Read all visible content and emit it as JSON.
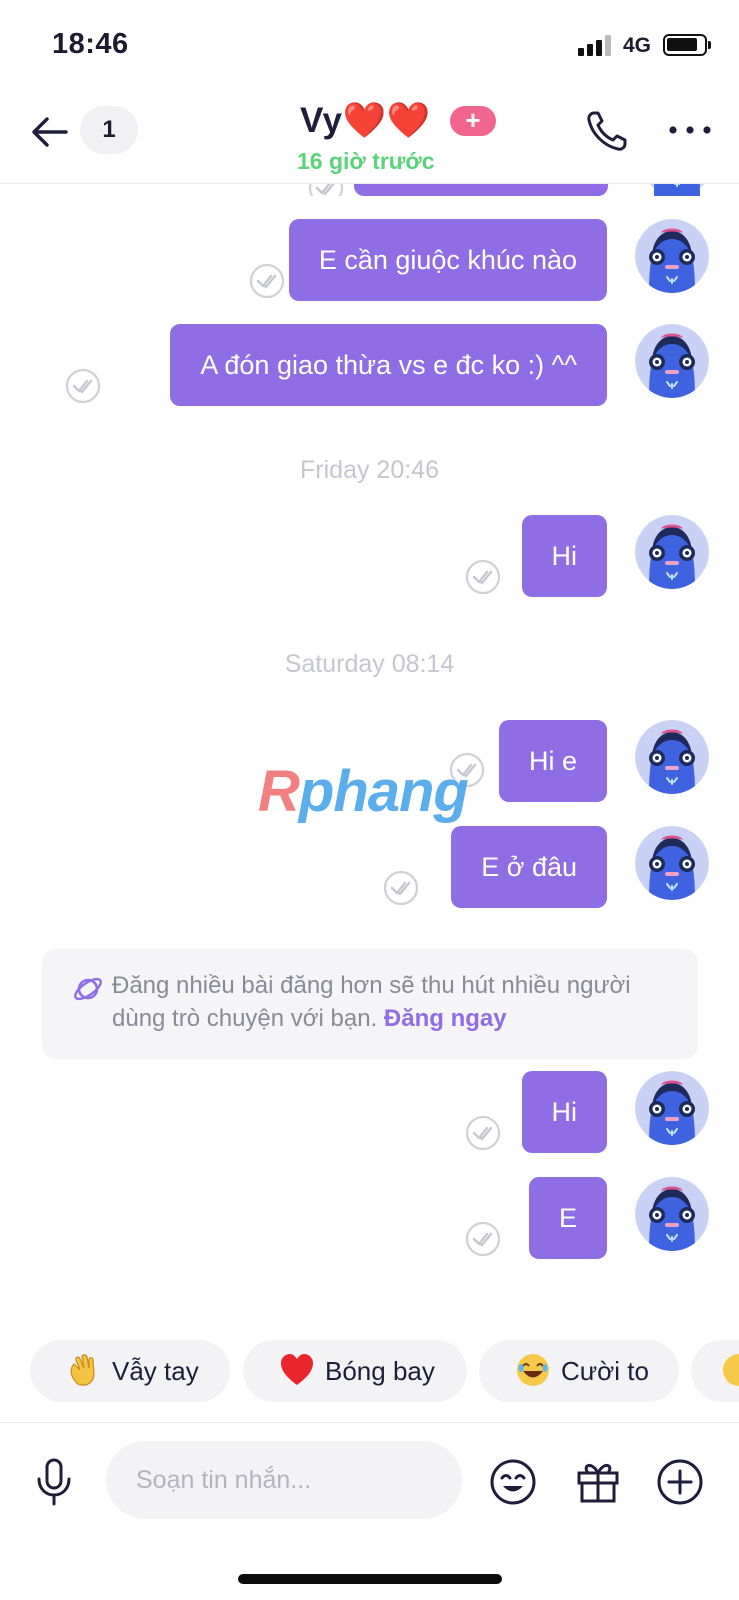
{
  "status_bar": {
    "time": "18:46",
    "network": "4G"
  },
  "header": {
    "unread_count": "1",
    "contact_name": "Vy❤️❤️",
    "plus_label": "+",
    "last_seen": "16 giờ trước"
  },
  "messages": [
    {
      "text": "E cần giuộc khúc nào"
    },
    {
      "text": "A đón giao thừa vs e đc ko :) ^^"
    },
    {
      "text": "Hi"
    },
    {
      "text": "Hi e"
    },
    {
      "text": "E ở đâu"
    },
    {
      "text": "Hi"
    },
    {
      "text": "E"
    }
  ],
  "date_separators": [
    "Friday 20:46",
    "Saturday 08:14"
  ],
  "watermark": {
    "part1": "R",
    "part2": "phang"
  },
  "tip": {
    "text": "Đăng nhiều bài đăng hơn sẽ thu hút nhiều người dùng trò chuyện với bạn.",
    "link": "Đăng ngay"
  },
  "quick_replies": [
    {
      "emoji": "wave",
      "label": "Vẫy tay"
    },
    {
      "emoji": "heart",
      "label": "Bóng bay"
    },
    {
      "emoji": "laugh",
      "label": "Cười to"
    }
  ],
  "composer": {
    "placeholder": "Soạn tin nhắn..."
  },
  "colors": {
    "accent": "#8f6de4",
    "online": "#5ad37a",
    "badge": "#f0668f"
  }
}
